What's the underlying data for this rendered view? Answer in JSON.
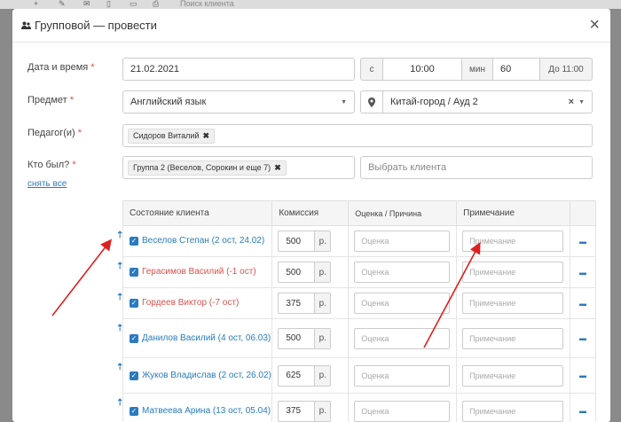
{
  "background": {
    "search_text": "Поиск клиента"
  },
  "modal": {
    "title": "Групповой — провести",
    "close_symbol": "×"
  },
  "form": {
    "datetime": {
      "label": "Дата и время",
      "required": "*",
      "date": "21.02.2021",
      "from_label": "с",
      "time": "10:00",
      "min_label": "мин",
      "minutes": "60",
      "until": "До 11:00"
    },
    "subject": {
      "label": "Предмет",
      "required": "*",
      "value": "Английский язык",
      "location": "Китай-город / Ауд 2"
    },
    "teacher": {
      "label": "Педагог(и)",
      "required": "*",
      "tag": "Сидоров Виталий"
    },
    "attendees": {
      "label": "Кто был?",
      "required": "*",
      "tag": "Группа 2 (Веселов, Сорокин и еще 7)",
      "client_placeholder": "Выбрать клиента",
      "clear_all": "снять все"
    }
  },
  "table": {
    "headers": [
      "Состояние клиента",
      "Комиссия",
      "Оценка / Причина",
      "Примечание"
    ],
    "currency": "р.",
    "grade_placeholder": "Оценка",
    "note_placeholder": "Примечание",
    "rows": [
      {
        "name": "Веселов Степан (2 ост, 24.02)",
        "color": "#2a7bbf",
        "commission": "500"
      },
      {
        "name": "Герасимов Василий (-1 ост)",
        "color": "#d9534f",
        "commission": "500"
      },
      {
        "name": "Гордеев Виктор (-7 ост)",
        "color": "#d9534f",
        "commission": "375"
      },
      {
        "name": "Данилов Василий (4 ост, 06.03)",
        "color": "#2a7bbf",
        "commission": "500"
      },
      {
        "name": "Жуков Владислав (2 ост, 26.02)",
        "color": "#2a7bbf",
        "commission": "625"
      },
      {
        "name": "Матвеева Арина (13 ост, 05.04)",
        "color": "#2a7bbf",
        "commission": "375"
      }
    ]
  },
  "colors": {
    "accent": "#2a7bbf",
    "danger": "#d9534f",
    "annotation": "#e02020"
  },
  "icons": {
    "title": "users-icon",
    "location": "map-pin-icon",
    "row_move": "arrow-up-icon",
    "remove": "minus-icon",
    "clear": "clear-x-icon",
    "dropdown": "chevron-down-icon"
  }
}
